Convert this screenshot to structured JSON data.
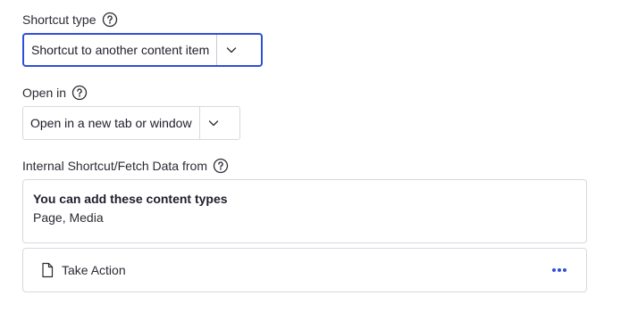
{
  "shortcut_type": {
    "label": "Shortcut type",
    "help_icon": "help-circle-icon",
    "value": "Shortcut to another content item",
    "chevron_icon": "chevron-down-icon"
  },
  "open_in": {
    "label": "Open in",
    "help_icon": "help-circle-icon",
    "value": "Open in a new tab or window",
    "chevron_icon": "chevron-down-icon"
  },
  "internal_shortcut": {
    "label": "Internal Shortcut/Fetch Data from",
    "help_icon": "help-circle-icon",
    "allowed_title": "You can add these content types",
    "allowed_types": "Page, Media",
    "items": [
      {
        "icon": "document-icon",
        "label": "Take Action",
        "menu_icon": "more-horizontal-icon"
      }
    ]
  },
  "colors": {
    "focus_border": "#2e4fd8",
    "accent": "#2e4fd8",
    "border": "#d8d9e0"
  }
}
